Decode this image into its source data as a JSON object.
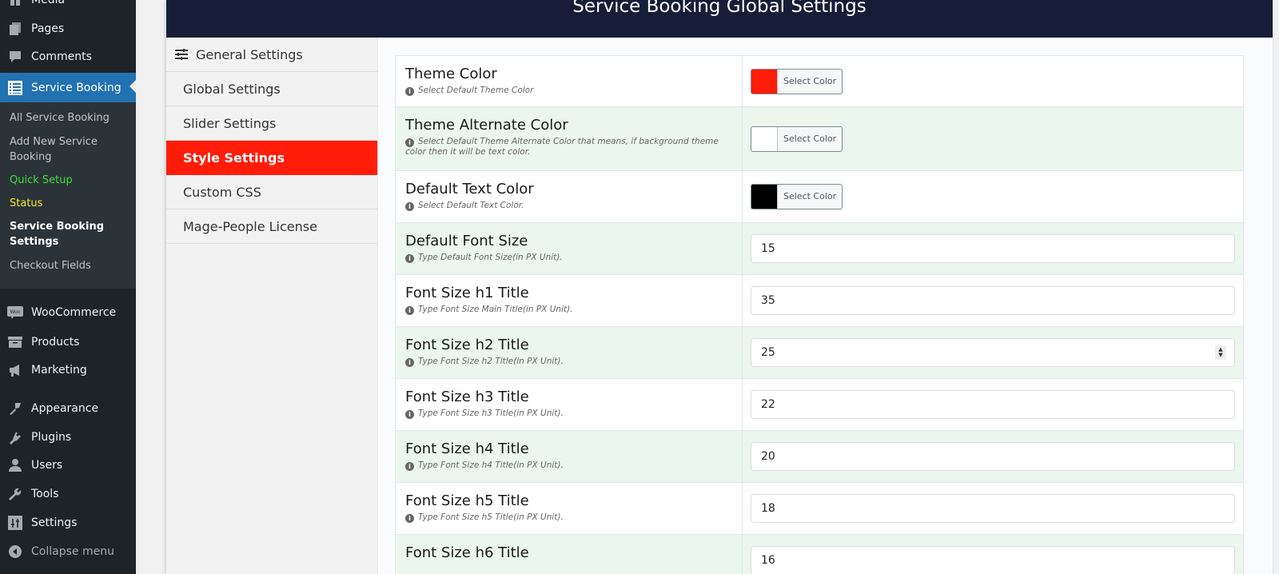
{
  "wp_menu": {
    "top_items": [
      {
        "label": "Media",
        "icon": "media-icon"
      },
      {
        "label": "Pages",
        "icon": "pages-icon"
      },
      {
        "label": "Comments",
        "icon": "comments-icon"
      },
      {
        "label": "Service Booking",
        "icon": "list-icon",
        "active": true
      }
    ],
    "submenu": [
      {
        "label": "All Service Booking",
        "style": "normal"
      },
      {
        "label": "Add New Service Booking",
        "style": "normal"
      },
      {
        "label": "Quick Setup",
        "style": "green"
      },
      {
        "label": "Status",
        "style": "yellow"
      },
      {
        "label": "Service Booking Settings",
        "style": "current"
      },
      {
        "label": "Checkout Fields",
        "style": "normal"
      }
    ],
    "bottom_items": [
      {
        "label": "WooCommerce",
        "icon": "woocommerce-icon"
      },
      {
        "label": "Products",
        "icon": "products-icon"
      },
      {
        "label": "Marketing",
        "icon": "megaphone-icon"
      },
      {
        "label": "Appearance",
        "icon": "paintbrush-icon"
      },
      {
        "label": "Plugins",
        "icon": "plug-icon"
      },
      {
        "label": "Users",
        "icon": "user-icon"
      },
      {
        "label": "Tools",
        "icon": "wrench-icon"
      },
      {
        "label": "Settings",
        "icon": "settings-icon"
      },
      {
        "label": "Collapse menu",
        "icon": "collapse-icon"
      }
    ]
  },
  "header": {
    "title": "Service Booking Global Settings"
  },
  "settings_nav": {
    "heading": "General Settings",
    "items": [
      {
        "label": "Global Settings"
      },
      {
        "label": "Slider Settings"
      },
      {
        "label": "Style Settings",
        "active": true
      },
      {
        "label": "Custom CSS"
      },
      {
        "label": "Mage-People License"
      }
    ]
  },
  "style_settings": {
    "select_color_label": "Select Color",
    "rows": [
      {
        "title": "Theme Color",
        "desc": "Select Default Theme Color",
        "type": "color",
        "value": "#ff1d0a"
      },
      {
        "title": "Theme Alternate Color",
        "desc": "Select Default Theme Alternate Color that means, if background theme color then it will be text color.",
        "type": "color",
        "value": "#ffffff"
      },
      {
        "title": "Default Text Color",
        "desc": "Select Default Text Color.",
        "type": "color",
        "value": "#000000"
      },
      {
        "title": "Default Font Size",
        "desc": "Type Default Font Size(in PX Unit).",
        "type": "number",
        "value": "15"
      },
      {
        "title": "Font Size h1 Title",
        "desc": "Type Font Size Main Title(in PX Unit).",
        "type": "number",
        "value": "35"
      },
      {
        "title": "Font Size h2 Title",
        "desc": "Type Font Size h2 Title(in PX Unit).",
        "type": "number",
        "value": "25",
        "focused": true
      },
      {
        "title": "Font Size h3 Title",
        "desc": "Type Font Size h3 Title(in PX Unit).",
        "type": "number",
        "value": "22"
      },
      {
        "title": "Font Size h4 Title",
        "desc": "Type Font Size h4 Title(in PX Unit).",
        "type": "number",
        "value": "20"
      },
      {
        "title": "Font Size h5 Title",
        "desc": "Type Font Size h5 Title(in PX Unit).",
        "type": "number",
        "value": "18"
      },
      {
        "title": "Font Size h6 Title",
        "desc": "",
        "type": "number",
        "value": "16"
      }
    ]
  },
  "colors": {
    "wp_sidebar": "#1d2327",
    "wp_active": "#2271b1",
    "header_bg": "#171c38",
    "nav_active": "#ff1d0a",
    "row_alt": "#eaf6ee"
  }
}
